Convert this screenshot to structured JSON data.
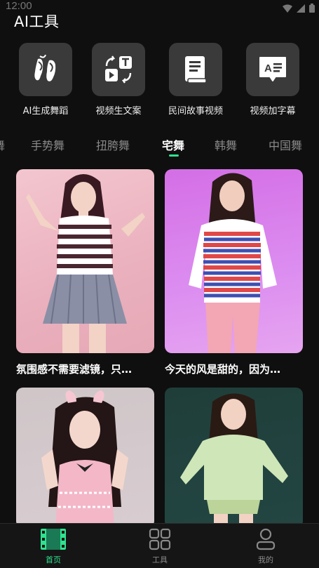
{
  "status_bar": {
    "time": "12:00"
  },
  "app_title": "AI工具",
  "tools": [
    {
      "label": "AI生成舞蹈",
      "icon": "ballet-shoes-icon"
    },
    {
      "label": "视频生文案",
      "icon": "video-to-text-icon"
    },
    {
      "label": "民间故事视频",
      "icon": "storybook-icon"
    },
    {
      "label": "视频加字幕",
      "icon": "subtitle-icon"
    }
  ],
  "tabs": [
    "舞",
    "手势舞",
    "扭胯舞",
    "宅舞",
    "韩舞",
    "中国舞"
  ],
  "active_tab": "宅舞",
  "feed": [
    {
      "title": "氛围感不需要滤镜，只…"
    },
    {
      "title": "今天的风是甜的，因为…"
    },
    {
      "title": ""
    },
    {
      "title": ""
    }
  ],
  "bottom_nav": [
    {
      "label": "首页",
      "icon": "film-icon",
      "active": true
    },
    {
      "label": "工具",
      "icon": "grid-icon",
      "active": false
    },
    {
      "label": "我的",
      "icon": "user-icon",
      "active": false
    }
  ],
  "colors": {
    "accent": "#2ee38f",
    "background": "#0f0f0f",
    "tile": "#3a3a3a"
  }
}
